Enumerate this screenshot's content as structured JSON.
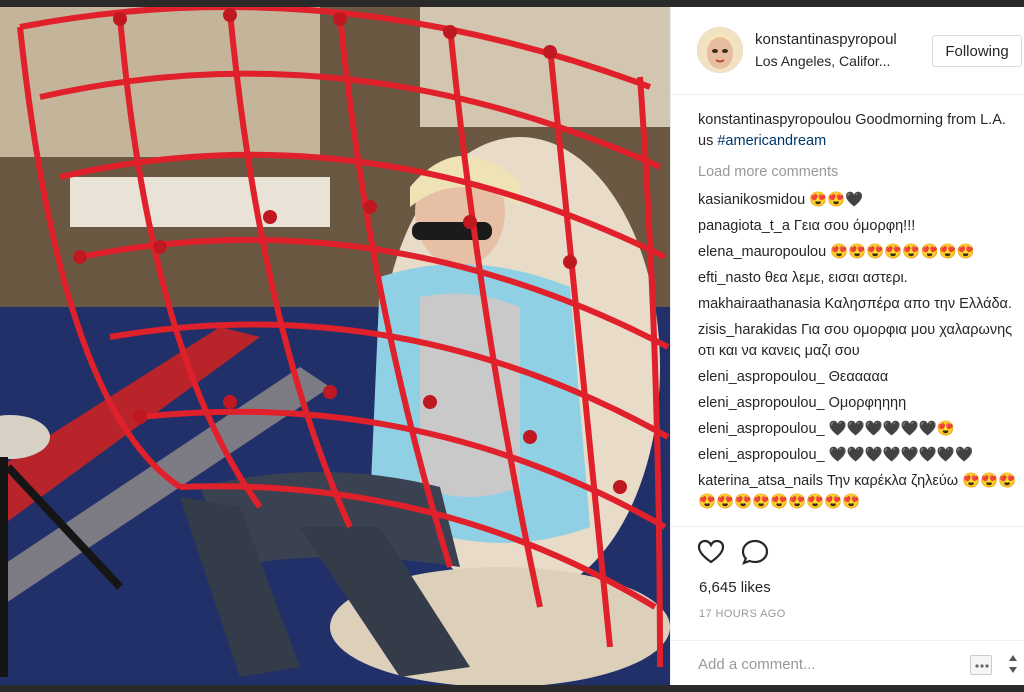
{
  "post": {
    "image_description_icon": "photo",
    "colors": {
      "net": "#e0202a",
      "carpet": "#1f2b5c",
      "chair": "#e8dcc8"
    }
  },
  "header": {
    "username": "konstantinaspyropoul",
    "location": "Los Angeles, Califor...",
    "follow_label": "Following"
  },
  "caption": {
    "user": "konstantinaspyropoulou",
    "text": "Goodmorning from L.A. us",
    "hashtag": "#americandream"
  },
  "load_more": "Load more comments",
  "comments": [
    {
      "user": "kasianikosmidou",
      "text": "😍😍🖤"
    },
    {
      "user": "panagiota_t_a",
      "text": "Γεια σου όμορφη!!!"
    },
    {
      "user": "elena_mauropoulou",
      "text": "😍😍😍😍😍😍😍😍"
    },
    {
      "user": "efti_nasto",
      "text": "θεα λεμε, εισαι αστερι."
    },
    {
      "user": "makhairaathanasia",
      "text": "Καλησπέρα απο την Ελλάδα."
    },
    {
      "user": "zisis_harakidas",
      "text": "Για σου ομορφια μου χαλαρωνης οτι και να κανεις μαζι σου"
    },
    {
      "user": "eleni_aspropoulou_",
      "text": "Θεααααα"
    },
    {
      "user": "eleni_aspropoulou_",
      "text": "Ομορφηηηη"
    },
    {
      "user": "eleni_aspropoulou_",
      "text": "🖤🖤🖤🖤🖤🖤😍"
    },
    {
      "user": "eleni_aspropoulou_",
      "text": "🖤🖤🖤🖤🖤🖤🖤🖤"
    },
    {
      "user": "katerina_atsa_nails",
      "text": "Την καρέκλα ζηλεύω 😍😍😍😍😍😍😍😍😍😍😍😍"
    }
  ],
  "actions": {
    "like_icon": "heart-icon",
    "comment_icon": "comment-bubble-icon",
    "likes": "6,645 likes",
    "time": "17 HOURS AGO",
    "add_comment_placeholder": "Add a comment..."
  }
}
